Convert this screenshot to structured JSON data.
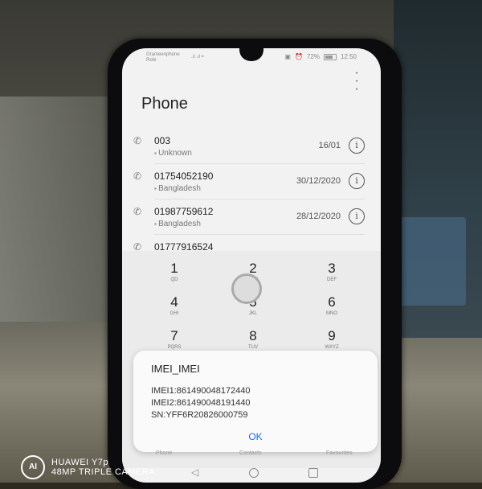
{
  "status_bar": {
    "carrier_line1": "Grameenphone",
    "carrier_line2": "Robi",
    "battery": "72%",
    "time": "12:50"
  },
  "app": {
    "title": "Phone"
  },
  "calls": [
    {
      "number": "003",
      "location": "Unknown",
      "date": "16/01"
    },
    {
      "number": "01754052190",
      "location": "Bangladesh",
      "date": "30/12/2020"
    },
    {
      "number": "01987759612",
      "location": "Bangladesh",
      "date": "28/12/2020"
    },
    {
      "number": "01777916524",
      "location": "",
      "date": ""
    }
  ],
  "dialpad": {
    "keys": [
      {
        "digit": "1",
        "letters": "QD"
      },
      {
        "digit": "2",
        "letters": "ABC"
      },
      {
        "digit": "3",
        "letters": "DEF"
      },
      {
        "digit": "4",
        "letters": "GHI"
      },
      {
        "digit": "5",
        "letters": "JKL"
      },
      {
        "digit": "6",
        "letters": "MNO"
      },
      {
        "digit": "7",
        "letters": "PQRS"
      },
      {
        "digit": "8",
        "letters": "TUV"
      },
      {
        "digit": "9",
        "letters": "WXYZ"
      }
    ]
  },
  "dialog": {
    "title": "IMEI_IMEI",
    "imei1": "IMEI1:861490048172440",
    "imei2": "IMEI2:861490048191440",
    "sn": "SN:YFF6R20826000759",
    "ok": "OK"
  },
  "tabs": {
    "phone": "Phone",
    "contacts": "Contacts",
    "favourites": "Favourites"
  },
  "watermark": {
    "badge": "AI",
    "line1": "HUAWEI Y7p",
    "line2": "48MP TRIPLE CAMERA"
  }
}
